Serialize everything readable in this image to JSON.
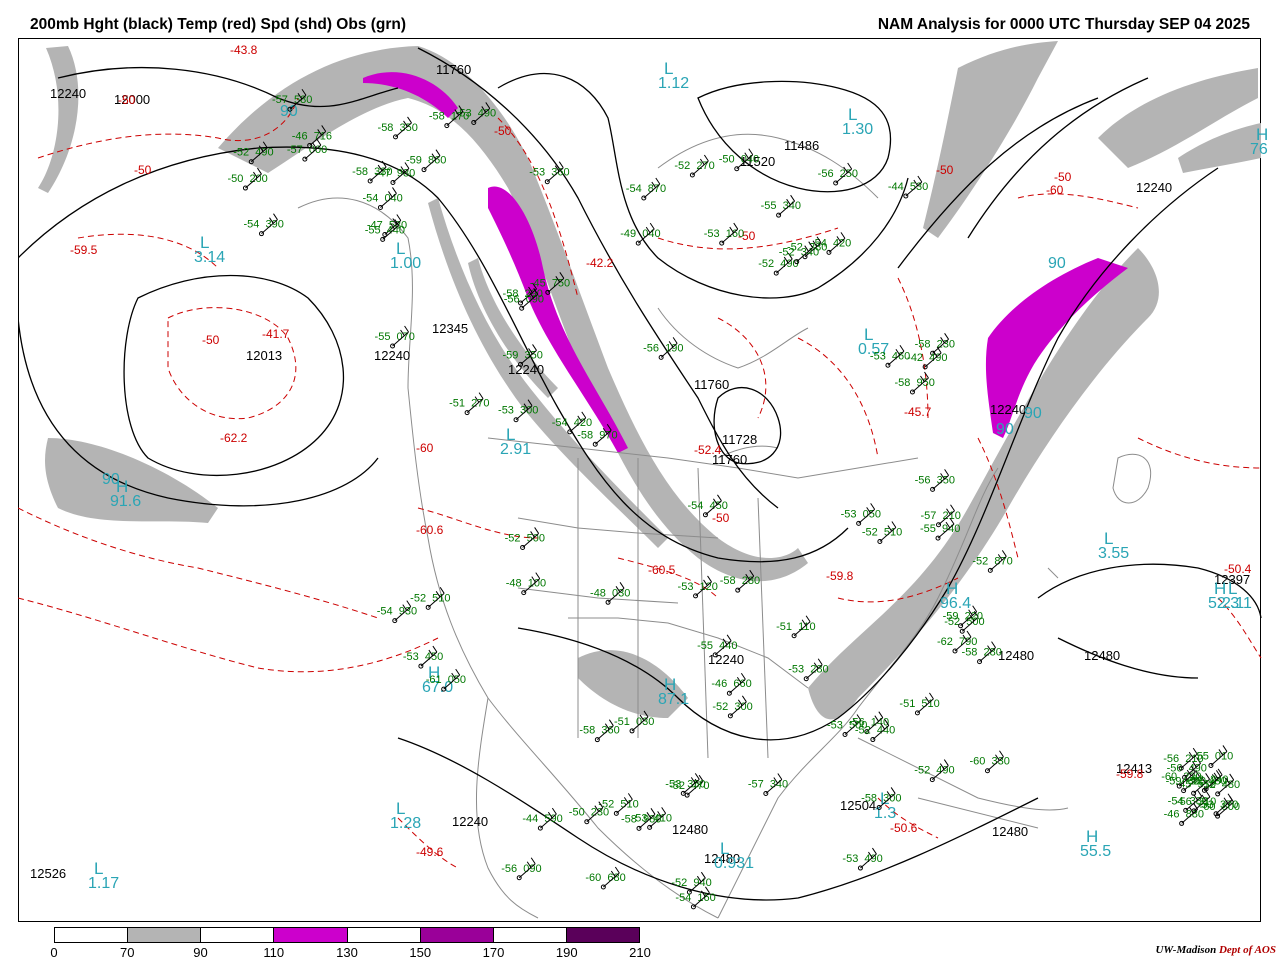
{
  "header": {
    "left_title": "200mb Hght (black) Temp (red) Spd (shd) Obs (grn)",
    "right_title": "NAM Analysis for 0000 UTC Thursday  SEP 04 2025"
  },
  "colors": {
    "height_contour": "#000000",
    "temperature_contour": "#cc0000",
    "observation": "#007700",
    "pressure_center": "#2aa5b5",
    "shade_70_90": "#b4b4b4",
    "shade_110_130": "#cc00cc",
    "shade_150_170": "#9a0099",
    "shade_190_210": "#5a005a",
    "map_lines": "#8c8c8c"
  },
  "legend": {
    "ticks": [
      "0",
      "70",
      "90",
      "110",
      "130",
      "150",
      "170",
      "190",
      "210"
    ],
    "fills": [
      "#ffffff",
      "#b4b4b4",
      "#ffffff",
      "#cc00cc",
      "#ffffff",
      "#9a0099",
      "#ffffff",
      "#5a005a"
    ]
  },
  "credit": {
    "org": "UW-Madison",
    "dept": "Dept of AOS"
  },
  "map": {
    "height_labels": [
      "12240",
      "12000",
      "11760",
      "11520",
      "11486",
      "12240",
      "12345",
      "12240",
      "12013",
      "12240",
      "12240",
      "11760",
      "11728",
      "11760",
      "12240",
      "12480",
      "12480",
      "12504",
      "12480",
      "12480",
      "12397",
      "12413",
      "12480",
      "12526",
      "12240"
    ],
    "temp_labels": [
      "-43.8",
      "-50",
      "-50",
      "-59.5",
      "-50",
      "-41.7",
      "-62.2",
      "-50",
      "-50",
      "-50",
      "-60",
      "-60",
      "-60.6",
      "-59.8",
      "-60.5",
      "-42.2",
      "-45.7",
      "-52.4",
      "-50.4",
      "-59.8",
      "-49.6",
      "-50.6",
      "-50",
      "-50"
    ],
    "centers": [
      {
        "letter": "L",
        "value": "3.14"
      },
      {
        "letter": "L",
        "value": "1.12"
      },
      {
        "letter": "L",
        "value": "1.30"
      },
      {
        "letter": "L",
        "value": "1.00"
      },
      {
        "letter": "L",
        "value": "0.57"
      },
      {
        "letter": "L",
        "value": "2.91"
      },
      {
        "letter": "L",
        "value": "3.55"
      },
      {
        "letter": "L",
        "value": "2.11"
      },
      {
        "letter": "L",
        "value": "0.931"
      },
      {
        "letter": "L",
        "value": "1.17"
      },
      {
        "letter": "L",
        "value": "1.28"
      },
      {
        "letter": "L",
        "value": "1.3"
      },
      {
        "letter": "H",
        "value": "91.6"
      },
      {
        "letter": "H",
        "value": "96.4"
      },
      {
        "letter": "H",
        "value": "52.3"
      },
      {
        "letter": "H",
        "value": "55.5"
      },
      {
        "letter": "H",
        "value": "67.0"
      },
      {
        "letter": "H",
        "value": "87.1"
      },
      {
        "letter": "H",
        "value": "76"
      }
    ],
    "speed_labels": [
      "90",
      "90",
      "90",
      "90",
      "90"
    ],
    "observations": [
      {
        "t": "-47",
        "h": "980"
      },
      {
        "t": "-55",
        "h": "070"
      },
      {
        "t": "-53",
        "h": "120"
      },
      {
        "t": "-56",
        "h": "190"
      },
      {
        "t": "-57",
        "h": "210"
      },
      {
        "t": "-56",
        "h": "310"
      },
      {
        "t": "-57",
        "h": "340"
      },
      {
        "t": "-58",
        "h": "350"
      },
      {
        "t": "-58",
        "h": "290"
      },
      {
        "t": "-58",
        "h": "280"
      },
      {
        "t": "-52",
        "h": "270"
      },
      {
        "t": "-60",
        "h": "330"
      },
      {
        "t": "-59",
        "h": "320"
      },
      {
        "t": "-58",
        "h": "300"
      },
      {
        "t": "-58",
        "h": "330"
      },
      {
        "t": "-59",
        "h": "350"
      },
      {
        "t": "-58",
        "h": "360"
      },
      {
        "t": "-55",
        "h": "340"
      },
      {
        "t": "-56",
        "h": "350"
      },
      {
        "t": "-54",
        "h": "380"
      },
      {
        "t": "-53",
        "h": "410"
      },
      {
        "t": "-54",
        "h": "390"
      },
      {
        "t": "-53",
        "h": "450"
      },
      {
        "t": "-54",
        "h": "450"
      },
      {
        "t": "-54",
        "h": "420"
      },
      {
        "t": "-52",
        "h": "500"
      },
      {
        "t": "-56",
        "h": "490"
      },
      {
        "t": "-52",
        "h": "470"
      },
      {
        "t": "-52",
        "h": "490"
      },
      {
        "t": "-52",
        "h": "500"
      },
      {
        "t": "-52",
        "h": "510"
      },
      {
        "t": "-52",
        "h": "490"
      },
      {
        "t": "-51",
        "h": "510"
      },
      {
        "t": "-52",
        "h": "480"
      },
      {
        "t": "-52",
        "h": "510"
      },
      {
        "t": "-53",
        "h": "490"
      },
      {
        "t": "-52",
        "h": "510"
      },
      {
        "t": "-53",
        "h": "500"
      },
      {
        "t": "-58",
        "h": "230"
      },
      {
        "t": "-59",
        "h": "220"
      },
      {
        "t": "-55",
        "h": "010"
      },
      {
        "t": "-58",
        "h": "980"
      },
      {
        "t": "-57",
        "h": "000"
      },
      {
        "t": "-48",
        "h": "100"
      },
      {
        "t": "-51",
        "h": "030"
      },
      {
        "t": "-49",
        "h": "040"
      },
      {
        "t": "-55",
        "h": "940"
      },
      {
        "t": "-46",
        "h": "880"
      },
      {
        "t": "-52",
        "h": "940"
      },
      {
        "t": "-59",
        "h": "860"
      },
      {
        "t": "-54",
        "h": "930"
      },
      {
        "t": "-53",
        "h": "050"
      },
      {
        "t": "-54",
        "h": "870"
      },
      {
        "t": "-62",
        "h": "790"
      },
      {
        "t": "-60",
        "h": "800"
      },
      {
        "t": "-60",
        "h": "680"
      },
      {
        "t": "-57",
        "h": "580"
      },
      {
        "t": "-47",
        "h": "580"
      },
      {
        "t": "-46",
        "h": "660"
      },
      {
        "t": "-44",
        "h": "530"
      },
      {
        "t": "-42",
        "h": "490"
      },
      {
        "t": "-45",
        "h": "510"
      },
      {
        "t": "-44",
        "h": "590"
      },
      {
        "t": "-46",
        "h": "716"
      },
      {
        "t": "-45",
        "h": "750"
      },
      {
        "t": "-58",
        "h": "970"
      },
      {
        "t": "-56",
        "h": "250"
      },
      {
        "t": "-58",
        "h": "950"
      },
      {
        "t": "-52",
        "h": "240"
      },
      {
        "t": "-56",
        "h": "090"
      },
      {
        "t": "-54",
        "h": "040"
      },
      {
        "t": "-61",
        "h": "050"
      },
      {
        "t": "-51",
        "h": "110"
      },
      {
        "t": "-53",
        "h": "160"
      },
      {
        "t": "-56",
        "h": "140"
      },
      {
        "t": "-56",
        "h": "210"
      },
      {
        "t": "-50",
        "h": "230"
      },
      {
        "t": "-50",
        "h": "200"
      },
      {
        "t": "-51",
        "h": "270"
      },
      {
        "t": "-52",
        "h": "300"
      },
      {
        "t": "-52",
        "h": "380"
      },
      {
        "t": "-52",
        "h": "440"
      },
      {
        "t": "-52",
        "h": "480"
      },
      {
        "t": "-53",
        "h": "490"
      },
      {
        "t": "-55",
        "h": "440"
      },
      {
        "t": "-54",
        "h": "420"
      },
      {
        "t": "-55",
        "h": "440"
      },
      {
        "t": "-53",
        "h": "460"
      },
      {
        "t": "-52",
        "h": "490"
      },
      {
        "t": "-53",
        "h": "370"
      },
      {
        "t": "-53",
        "h": "350"
      },
      {
        "t": "-53",
        "h": "360"
      },
      {
        "t": "-53",
        "h": "300"
      },
      {
        "t": "-53",
        "h": "280"
      },
      {
        "t": "-52",
        "h": "340"
      },
      {
        "t": "-58",
        "h": "280"
      },
      {
        "t": "-60",
        "h": "220"
      },
      {
        "t": "-54",
        "h": "160"
      },
      {
        "t": "-58",
        "h": "170"
      },
      {
        "t": "-56",
        "h": "090"
      },
      {
        "t": "-48",
        "h": "030"
      },
      {
        "t": "-50",
        "h": "040"
      },
      {
        "t": "-52",
        "h": "870"
      }
    ]
  }
}
